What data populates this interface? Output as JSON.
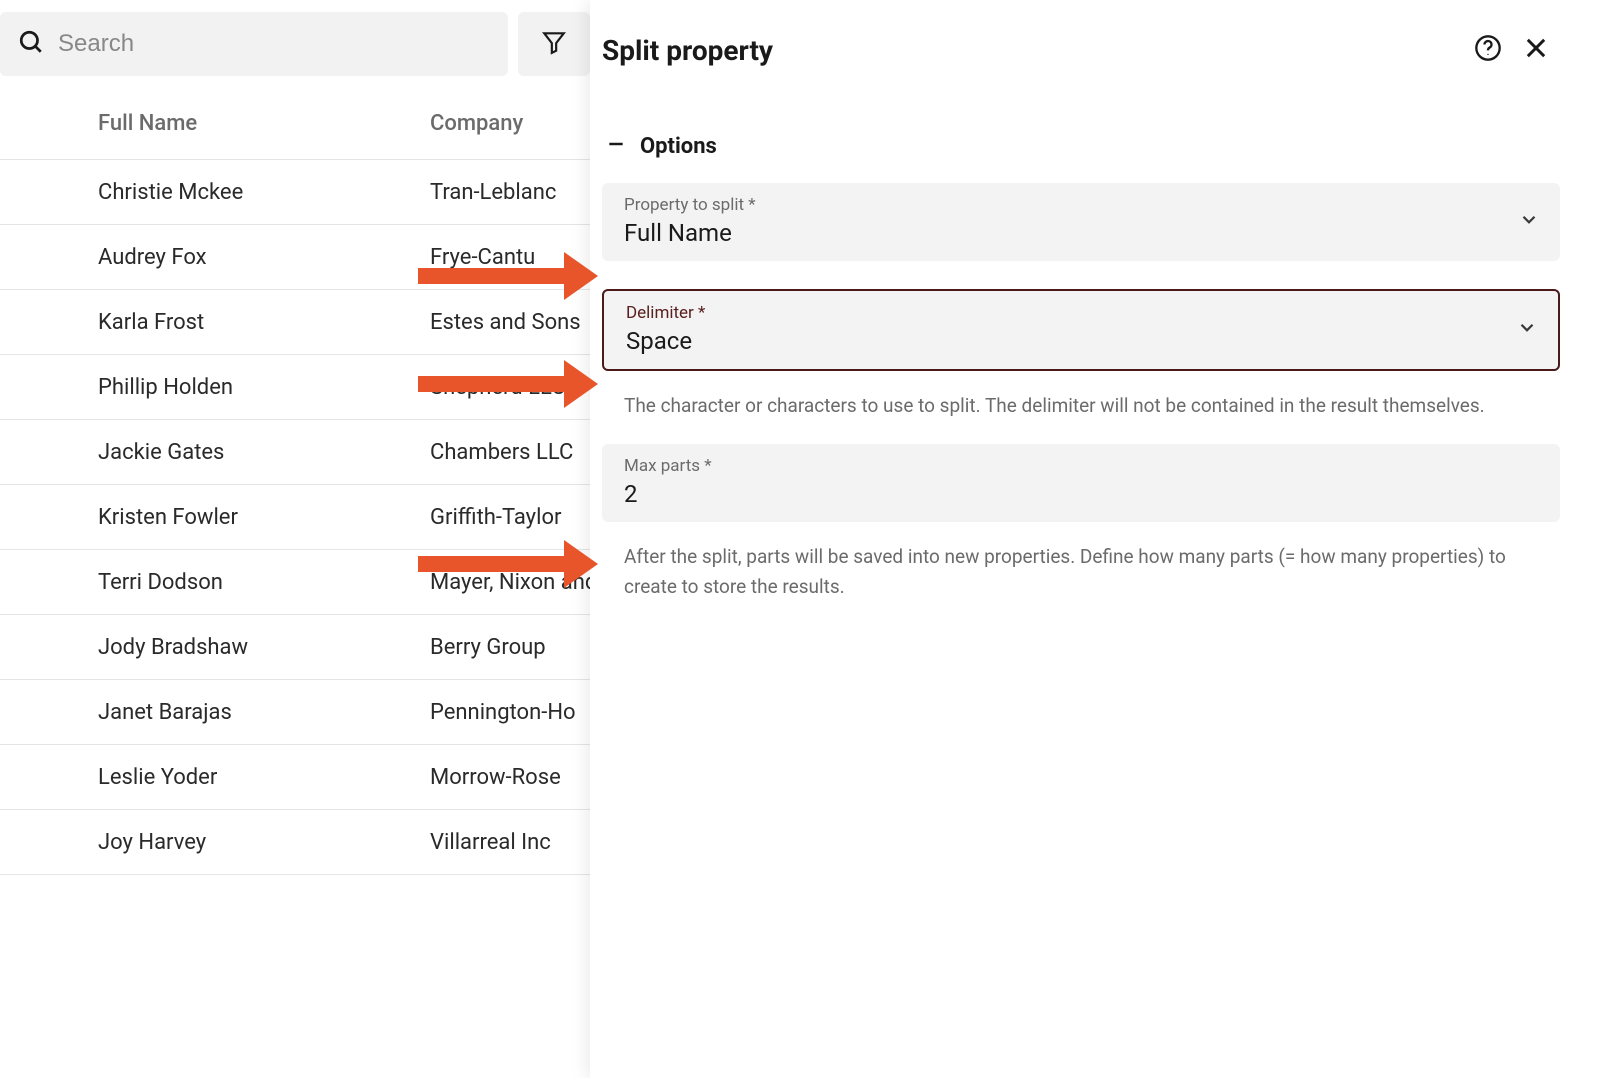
{
  "search": {
    "placeholder": "Search"
  },
  "table": {
    "columns": {
      "name": "Full Name",
      "company": "Company"
    },
    "rows": [
      {
        "name": "Christie Mckee",
        "company": "Tran-Leblanc"
      },
      {
        "name": "Audrey Fox",
        "company": "Frye-Cantu"
      },
      {
        "name": "Karla Frost",
        "company": "Estes and Sons"
      },
      {
        "name": "Phillip Holden",
        "company": "Shepherd LLC"
      },
      {
        "name": "Jackie Gates",
        "company": "Chambers LLC"
      },
      {
        "name": "Kristen Fowler",
        "company": "Griffith-Taylor"
      },
      {
        "name": "Terri Dodson",
        "company": "Mayer, Nixon and"
      },
      {
        "name": "Jody Bradshaw",
        "company": "Berry Group"
      },
      {
        "name": "Janet Barajas",
        "company": "Pennington-Ho"
      },
      {
        "name": "Leslie Yoder",
        "company": "Morrow-Rose"
      },
      {
        "name": "Joy Harvey",
        "company": "Villarreal Inc"
      }
    ]
  },
  "panel": {
    "title": "Split property",
    "section_title": "Options",
    "fields": {
      "property": {
        "label": "Property to split *",
        "value": "Full Name"
      },
      "delimiter": {
        "label": "Delimiter *",
        "value": "Space",
        "help": "The character or characters to use to split. The delimiter will not be contained in the result themselves."
      },
      "maxparts": {
        "label": "Max parts *",
        "value": "2",
        "help": "After the split, parts will be saved into new properties. Define how many parts (= how many properties) to create to store the results."
      }
    }
  }
}
